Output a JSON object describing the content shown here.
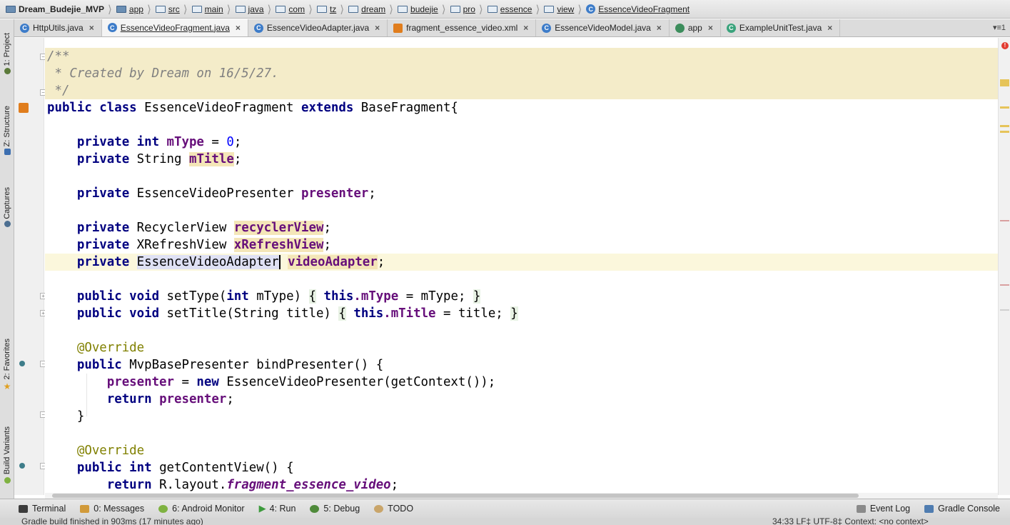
{
  "breadcrumb": [
    {
      "label": "Dream_Budejie_MVP",
      "icon": "project-folder-icon"
    },
    {
      "label": "app",
      "icon": "module-folder-icon"
    },
    {
      "label": "src",
      "icon": "folder-icon"
    },
    {
      "label": "main",
      "icon": "folder-icon"
    },
    {
      "label": "java",
      "icon": "folder-icon"
    },
    {
      "label": "com",
      "icon": "package-icon"
    },
    {
      "label": "tz",
      "icon": "package-icon"
    },
    {
      "label": "dream",
      "icon": "package-icon"
    },
    {
      "label": "budejie",
      "icon": "package-icon"
    },
    {
      "label": "pro",
      "icon": "package-icon"
    },
    {
      "label": "essence",
      "icon": "package-icon"
    },
    {
      "label": "view",
      "icon": "package-icon"
    },
    {
      "label": "EssenceVideoFragment",
      "icon": "class-icon"
    }
  ],
  "tabs": [
    {
      "label": "HttpUtils.java",
      "icon": "class-icon",
      "active": false
    },
    {
      "label": "EssenceVideoFragment.java",
      "icon": "class-icon",
      "active": true
    },
    {
      "label": "EssenceVideoAdapter.java",
      "icon": "class-icon",
      "active": false
    },
    {
      "label": "fragment_essence_video.xml",
      "icon": "xml-file-icon",
      "active": false
    },
    {
      "label": "EssenceVideoModel.java",
      "icon": "class-icon",
      "active": false
    },
    {
      "label": "app",
      "icon": "module-icon",
      "active": false
    },
    {
      "label": "ExampleUnitTest.java",
      "icon": "test-class-icon",
      "active": false
    }
  ],
  "tab_close_glyph": "×",
  "tab_overflow": "▾≡1",
  "left_tools": [
    {
      "label": "1: Project",
      "icon": "project-icon"
    },
    {
      "label": "Z: Structure",
      "icon": "structure-icon"
    },
    {
      "label": "Captures",
      "icon": "captures-icon"
    },
    {
      "label": "2: Favorites",
      "icon": "favorites-star-icon"
    },
    {
      "label": "Build Variants",
      "icon": "android-icon"
    }
  ],
  "code": {
    "l1": "/**",
    "l2": " * Created by Dream on 16/5/27.",
    "l3": " */",
    "l4_kw": "public class",
    "l4_name": "EssenceVideoFragment",
    "l4_ext": "extends",
    "l4_base": "BaseFragment{",
    "l6_kw": "private int",
    "l6_field": "mType",
    "l6_eq": " = ",
    "l6_num": "0",
    "l6_end": ";",
    "l7_kw": "private",
    "l7_type": "String",
    "l7_field": "mTitle",
    "l7_end": ";",
    "l9_kw": "private",
    "l9_type": "EssenceVideoPresenter",
    "l9_field": "presenter",
    "l9_end": ";",
    "l11_kw": "private",
    "l11_type": "RecyclerView",
    "l11_field": "recyclerView",
    "l11_end": ";",
    "l12_kw": "private",
    "l12_type": "XRefreshView",
    "l12_field": "xRefreshView",
    "l12_end": ";",
    "l13_kw": "private",
    "l13_type": "EssenceVideoAdapter",
    "l13_field": "videoAdapter",
    "l13_end": ";",
    "l15_kw": "public void",
    "l15_sig": "setType(",
    "l15_int": "int",
    "l15_param": "mType)",
    "l15_open": "{",
    "l15_this": "this",
    "l15_field": ".mType",
    "l15_rest": " = mType; ",
    "l15_close": "}",
    "l16_kw": "public void",
    "l16_sig": "setTitle(String title)",
    "l16_open": "{",
    "l16_this": "this",
    "l16_field": ".mTitle",
    "l16_rest": " = title; ",
    "l16_close": "}",
    "l18_ann": "@Override",
    "l19_kw": "public",
    "l19_rest": "MvpBasePresenter bindPresenter() {",
    "l20_field": "presenter",
    "l20_eq": " = ",
    "l20_new": "new",
    "l20_rest": "EssenceVideoPresenter(getContext());",
    "l21_kw": "return",
    "l21_field": "presenter",
    "l21_end": ";",
    "l22": "}",
    "l24_ann": "@Override",
    "l25_kw": "public int",
    "l25_rest": "getContentView() {",
    "l26_kw": "return",
    "l26_rest": "R.layout.",
    "l26_field": "fragment_essence_video",
    "l26_end": ";"
  },
  "bottom_tools": [
    {
      "label": "Terminal",
      "icon": "terminal-icon"
    },
    {
      "label": "0: Messages",
      "icon": "messages-icon"
    },
    {
      "label": "6: Android Monitor",
      "icon": "android-monitor-icon"
    },
    {
      "label": "4: Run",
      "icon": "run-icon"
    },
    {
      "label": "5: Debug",
      "icon": "debug-icon"
    },
    {
      "label": "TODO",
      "icon": "todo-icon"
    }
  ],
  "bottom_right_tools": [
    {
      "label": "Event Log",
      "icon": "event-log-icon"
    },
    {
      "label": "Gradle Console",
      "icon": "gradle-console-icon"
    }
  ],
  "status": {
    "message": "Gradle build finished in 903ms (17 minutes ago)",
    "right": "34:33   LF‡   UTF-8‡   Context: <no context>"
  },
  "colors": {
    "keyword": "#000080",
    "field": "#660e7a",
    "comment": "#808080",
    "number": "#0000ff",
    "annotation": "#808000",
    "error": "#e23b30"
  }
}
